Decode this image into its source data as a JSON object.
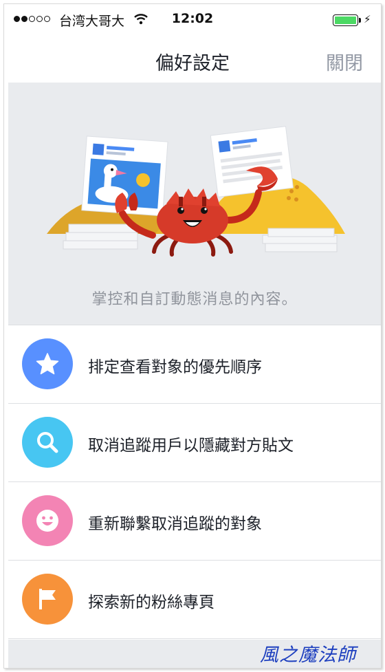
{
  "status_bar": {
    "signal_bars_filled": 2,
    "signal_bars_total": 5,
    "carrier": "台湾大哥大",
    "time": "12:02",
    "battery_level": 1.0,
    "battery_color": "#4cd964"
  },
  "nav": {
    "title": "偏好設定",
    "close_label": "關閉"
  },
  "hero": {
    "caption": "掌控和自訂動態消息的內容。"
  },
  "menu": {
    "items": [
      {
        "label": "排定查看對象的優先順序",
        "icon": "star-icon",
        "color": "#5890ff"
      },
      {
        "label": "取消追蹤用戶以隱藏對方貼文",
        "icon": "search-icon",
        "color": "#47c6f2"
      },
      {
        "label": "重新聯繫取消追蹤的對象",
        "icon": "smiley-icon",
        "color": "#f384b4"
      },
      {
        "label": "探索新的粉絲專頁",
        "icon": "flag-icon",
        "color": "#f7923a"
      }
    ]
  },
  "watermark": "風之魔法師"
}
